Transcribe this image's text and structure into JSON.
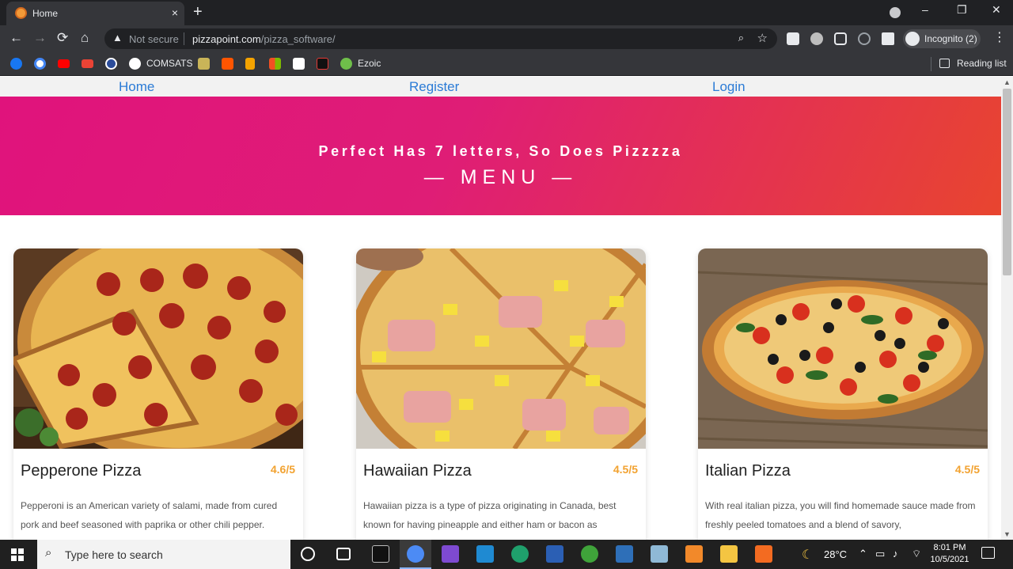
{
  "browser": {
    "tab": {
      "title": "Home",
      "close_icon": "×",
      "new_tab_icon": "+"
    },
    "window_controls": {
      "minimize": "–",
      "maximize": "❐",
      "close": "✕"
    },
    "nav": {
      "back": "←",
      "forward": "→",
      "reload": "⟳",
      "home": "⌂"
    },
    "address": {
      "security_label": "Not secure",
      "url_host": "pizzapoint.com",
      "url_path": "/pizza_software/",
      "warning_icon": "▲",
      "zoom_icon": "⌕",
      "star_icon": "☆"
    },
    "profile": {
      "label": "Incognito (2)"
    },
    "menu_icon": "⋮",
    "bookmarks": [
      {
        "label": "COMSATS"
      },
      {
        "label": "Ezoic"
      }
    ],
    "reading_list": "Reading list"
  },
  "site": {
    "nav": {
      "home": "Home",
      "register": "Register",
      "login": "Login"
    },
    "hero": {
      "tagline": "Perfect Has 7 letters, So Does Pizzzza",
      "heading": "— MENU —"
    },
    "items": [
      {
        "name": "Pepperone Pizza",
        "rating": "4.6/5",
        "description": "Pepperoni is an American variety of salami, made from cured pork and beef seasoned with paprika or other chili pepper."
      },
      {
        "name": "Hawaiian Pizza",
        "rating": "4.5/5",
        "description": "Hawaiian pizza is a type of pizza originating in Canada, best known for having pineapple and either ham or bacon as"
      },
      {
        "name": "Italian Pizza",
        "rating": "4.5/5",
        "description": "With real italian pizza, you will find homemade sauce made from freshly peeled tomatoes and a blend of savory,"
      }
    ]
  },
  "taskbar": {
    "search_placeholder": "Type here to search",
    "temperature": "28°C",
    "time": "8:01 PM",
    "date": "10/5/2021"
  },
  "colors": {
    "hero_start": "#e0137c",
    "hero_end": "#e8452f",
    "nav_link": "#2b7bd6",
    "rating": "#f2a230"
  }
}
